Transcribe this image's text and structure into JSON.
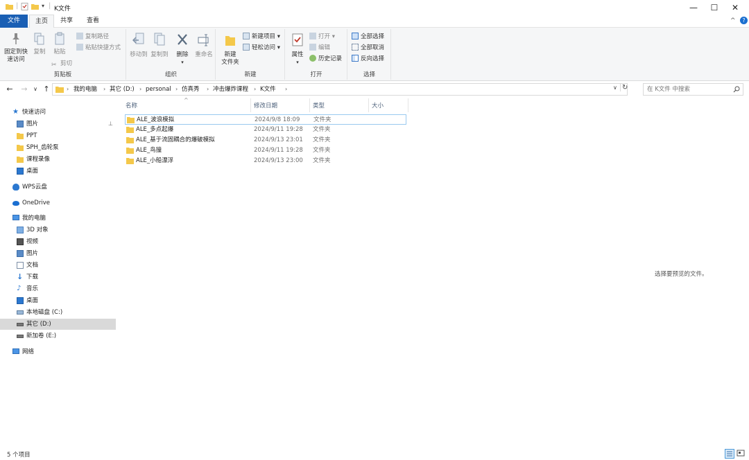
{
  "window": {
    "title": "K文件",
    "minimize": "—",
    "maximize": "☐",
    "close": "✕",
    "help": "?",
    "collapse": "^"
  },
  "tabs": [
    {
      "label": "文件"
    },
    {
      "label": "主页"
    },
    {
      "label": "共享"
    },
    {
      "label": "查看"
    }
  ],
  "ribbon": {
    "clipboard": {
      "label": "剪贴板",
      "pin_label_1": "固定到快",
      "pin_label_2": "速访问",
      "copy": "复制",
      "paste": "粘贴",
      "copy_path": "复制路径",
      "paste_shortcut": "粘贴快捷方式",
      "cut": "剪切"
    },
    "organize": {
      "label": "组织",
      "move_to": "移动到",
      "copy_to": "复制到",
      "delete": "删除",
      "rename": "重命名"
    },
    "new": {
      "label": "新建",
      "new_folder_1": "新建",
      "new_folder_2": "文件夹",
      "new_item": "新建项目 ▾",
      "easy_access": "轻松访问 ▾"
    },
    "open": {
      "label": "打开",
      "properties": "属性",
      "open": "打开 ▾",
      "edit": "编辑",
      "history": "历史记录"
    },
    "select": {
      "label": "选择",
      "select_all": "全部选择",
      "select_none": "全部取消",
      "invert": "反向选择"
    }
  },
  "address": {
    "back": "←",
    "forward": "→",
    "recent": "∨",
    "up": "↑",
    "crumbs": [
      "我的电脑",
      "其它 (D:)",
      "personal",
      "仿真秀",
      "冲击爆炸课程",
      "K文件"
    ],
    "refresh": "↻",
    "dropdown": "∨",
    "search_placeholder": "在 K文件 中搜索"
  },
  "nav": {
    "quick_access": "快速访问",
    "quick_items": [
      "图片",
      "PPT",
      "SPH_齿轮泵",
      "课程录像",
      "桌面"
    ],
    "wps": "WPS云盘",
    "onedrive": "OneDrive",
    "this_pc": "我的电脑",
    "pc_items": [
      "3D 对象",
      "视频",
      "图片",
      "文档",
      "下载",
      "音乐",
      "桌面",
      "本地磁盘 (C:)",
      "其它 (D:)",
      "新加卷 (E:)"
    ],
    "network": "网络"
  },
  "columns": {
    "name": "名称",
    "date": "修改日期",
    "type": "类型",
    "size": "大小"
  },
  "files": [
    {
      "name": "ALE_波浪模拟",
      "date": "2024/9/8 18:09",
      "type": "文件夹"
    },
    {
      "name": "ALE_多点起爆",
      "date": "2024/9/11 19:28",
      "type": "文件夹"
    },
    {
      "name": "ALE_基于流固耦合的爆破模拟",
      "date": "2024/9/13 23:01",
      "type": "文件夹"
    },
    {
      "name": "ALE_鸟撞",
      "date": "2024/9/11 19:28",
      "type": "文件夹"
    },
    {
      "name": "ALE_小船漂浮",
      "date": "2024/9/13 23:00",
      "type": "文件夹"
    }
  ],
  "preview_message": "选择要预览的文件。",
  "status": {
    "count": "5 个项目"
  },
  "colors": {
    "accent": "#1a5fb4",
    "folder": "#f4c84a",
    "selection": "#d9d9d9",
    "hover_border": "#99c9ef"
  }
}
